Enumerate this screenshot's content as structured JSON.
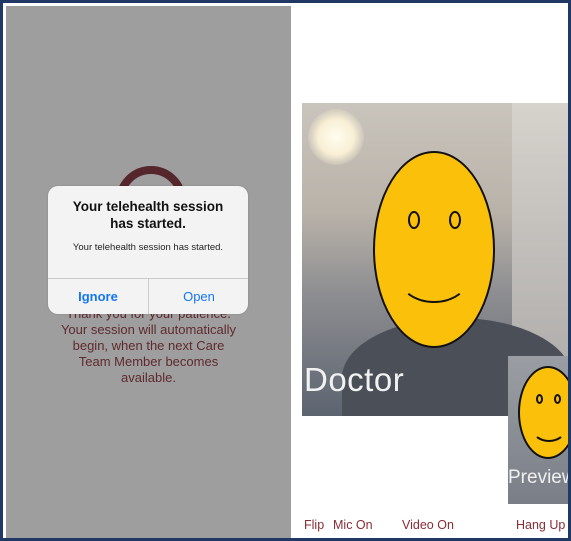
{
  "left_screen": {
    "background_text_lines": [
      "Thank you for your patience.",
      "Your session will automatically",
      "begin, when the next Care",
      "Team Member becomes",
      "available."
    ],
    "alert": {
      "title_line1": "Your telehealth session",
      "title_line2": "has started.",
      "message": "Your telehealth session has started.",
      "ignore_label": "Ignore",
      "open_label": "Open"
    }
  },
  "right_screen": {
    "remote_label": "Doctor",
    "preview_label": "Preview",
    "toolbar": {
      "flip_label": "Flip",
      "mic_label": "Mic On",
      "video_label": "Video On",
      "hangup_label": "Hang Up"
    }
  },
  "colors": {
    "frame_border": "#1f3864",
    "accent": "#8a2b35",
    "alert_button": "#1476f6",
    "emoji_face": "#fbc009"
  },
  "icons": [
    "smiley-face-icon"
  ]
}
